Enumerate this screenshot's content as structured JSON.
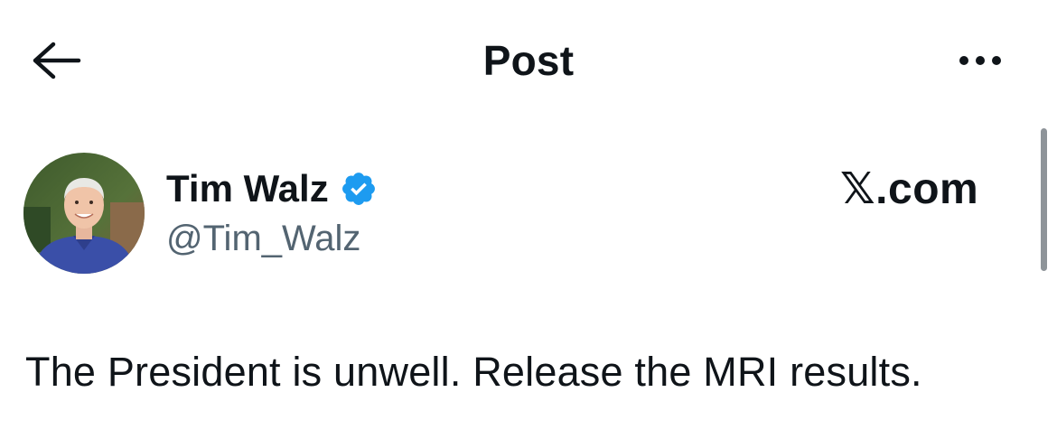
{
  "header": {
    "title": "Post",
    "back_icon": "arrow-left-icon",
    "more_icon": "more-horizontal-icon"
  },
  "post": {
    "author": {
      "name": "Tim Walz",
      "handle": "@Tim_Walz",
      "verified": true,
      "verified_color": "#1d9bf0",
      "avatar_icon": "profile-photo"
    },
    "watermark": "𝕏.com",
    "text": "The President is unwell. Release the MRI results."
  },
  "colors": {
    "text_primary": "#0f1419",
    "text_secondary": "#536471",
    "accent": "#1d9bf0",
    "background": "#ffffff"
  }
}
